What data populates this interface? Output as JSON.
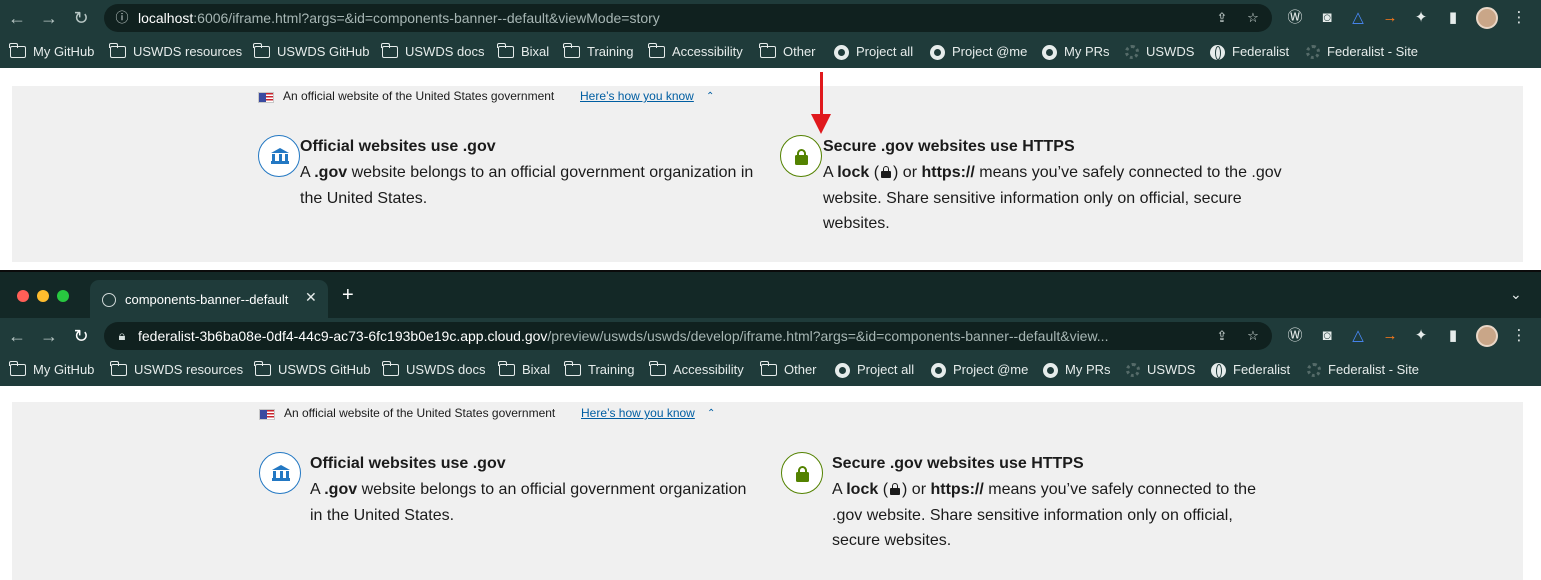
{
  "window1": {
    "url_host": "localhost",
    "url_rest": ":6006/iframe.html?args=&id=components-banner--default&viewMode=story"
  },
  "window2": {
    "tab_title": "components-banner--default",
    "url_host": "federalist-3b6ba08e-0df4-44c9-ac73-6fc193b0e19c.app.cloud.gov",
    "url_rest": "/preview/uswds/uswds/develop/iframe.html?args=&id=components-banner--default&view..."
  },
  "bookmarks": [
    {
      "label": "My GitHub",
      "icon": "folder-icon"
    },
    {
      "label": "USWDS resources",
      "icon": "folder-icon"
    },
    {
      "label": "USWDS GitHub",
      "icon": "folder-icon"
    },
    {
      "label": "USWDS docs",
      "icon": "folder-icon"
    },
    {
      "label": "Bixal",
      "icon": "folder-icon"
    },
    {
      "label": "Training",
      "icon": "folder-icon"
    },
    {
      "label": "Accessibility",
      "icon": "folder-icon"
    },
    {
      "label": "Other",
      "icon": "folder-icon"
    },
    {
      "label": "Project all",
      "icon": "github-icon"
    },
    {
      "label": "Project @me",
      "icon": "github-icon"
    },
    {
      "label": "My PRs",
      "icon": "github-icon"
    },
    {
      "label": "USWDS",
      "icon": "gear-icon"
    },
    {
      "label": "Federalist",
      "icon": "globe-icon"
    },
    {
      "label": "Federalist - Site",
      "icon": "gear-icon"
    }
  ],
  "banner": {
    "official_text": "An official website of the United States government",
    "how_link": "Here’s how you know",
    "dotgov": {
      "title": "Official websites use .gov",
      "body_a": "A ",
      "body_gov": ".gov",
      "body_rest": " website belongs to an official government organization in the United States."
    },
    "https": {
      "title": "Secure .gov websites use HTTPS",
      "body_a": "A ",
      "body_lock": "lock",
      "body_paren_open": " (",
      "body_paren_close": ") or ",
      "body_https": "https://",
      "body_rest": " means you’ve safely connected to the .gov website. Share sensitive information only on official, secure websites."
    }
  },
  "colors": {
    "chrome": "#1f3b3a",
    "banner_bg": "#f0f0f0",
    "link": "#005ea2",
    "dotgov_icon": "#2378c3",
    "https_icon": "#538200",
    "annotation_arrow": "#e0191d"
  }
}
